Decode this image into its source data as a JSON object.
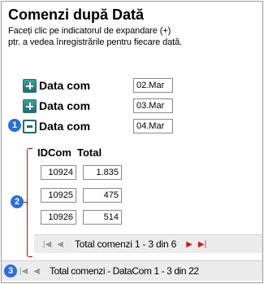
{
  "title": "Comenzi după Dată",
  "description_line1": "Faceți clic pe indicatorul de expandare (+)",
  "description_line2": "ptr. a vedea înregistrările pentru fiecare dată.",
  "groups": [
    {
      "label": "Data com",
      "value": "02.Mar",
      "state": "collapsed"
    },
    {
      "label": "Data com",
      "value": "03.Mar",
      "state": "collapsed"
    },
    {
      "label": "Data com",
      "value": "04.Mar",
      "state": "expanded"
    }
  ],
  "callouts": {
    "c1": "1",
    "c2": "2",
    "c3": "3"
  },
  "subform": {
    "headers": {
      "id": "IDCom",
      "total": "Total"
    },
    "rows": [
      {
        "id": "10924",
        "total": "1.835"
      },
      {
        "id": "10925",
        "total": "475"
      },
      {
        "id": "10926",
        "total": "514"
      }
    ],
    "nav_text": "Total comenzi 1 - 3 din 6"
  },
  "outer_nav_text": "Total comenzi - DataCom 1 - 3 din 22",
  "colors": {
    "accent_teal": "#1f6e6e",
    "bracket_red": "#d60000",
    "callout_blue": "#2b6fd6"
  },
  "icons": {
    "first": "first-record-icon",
    "prev": "previous-record-icon",
    "next": "next-record-icon",
    "last": "last-record-icon"
  }
}
